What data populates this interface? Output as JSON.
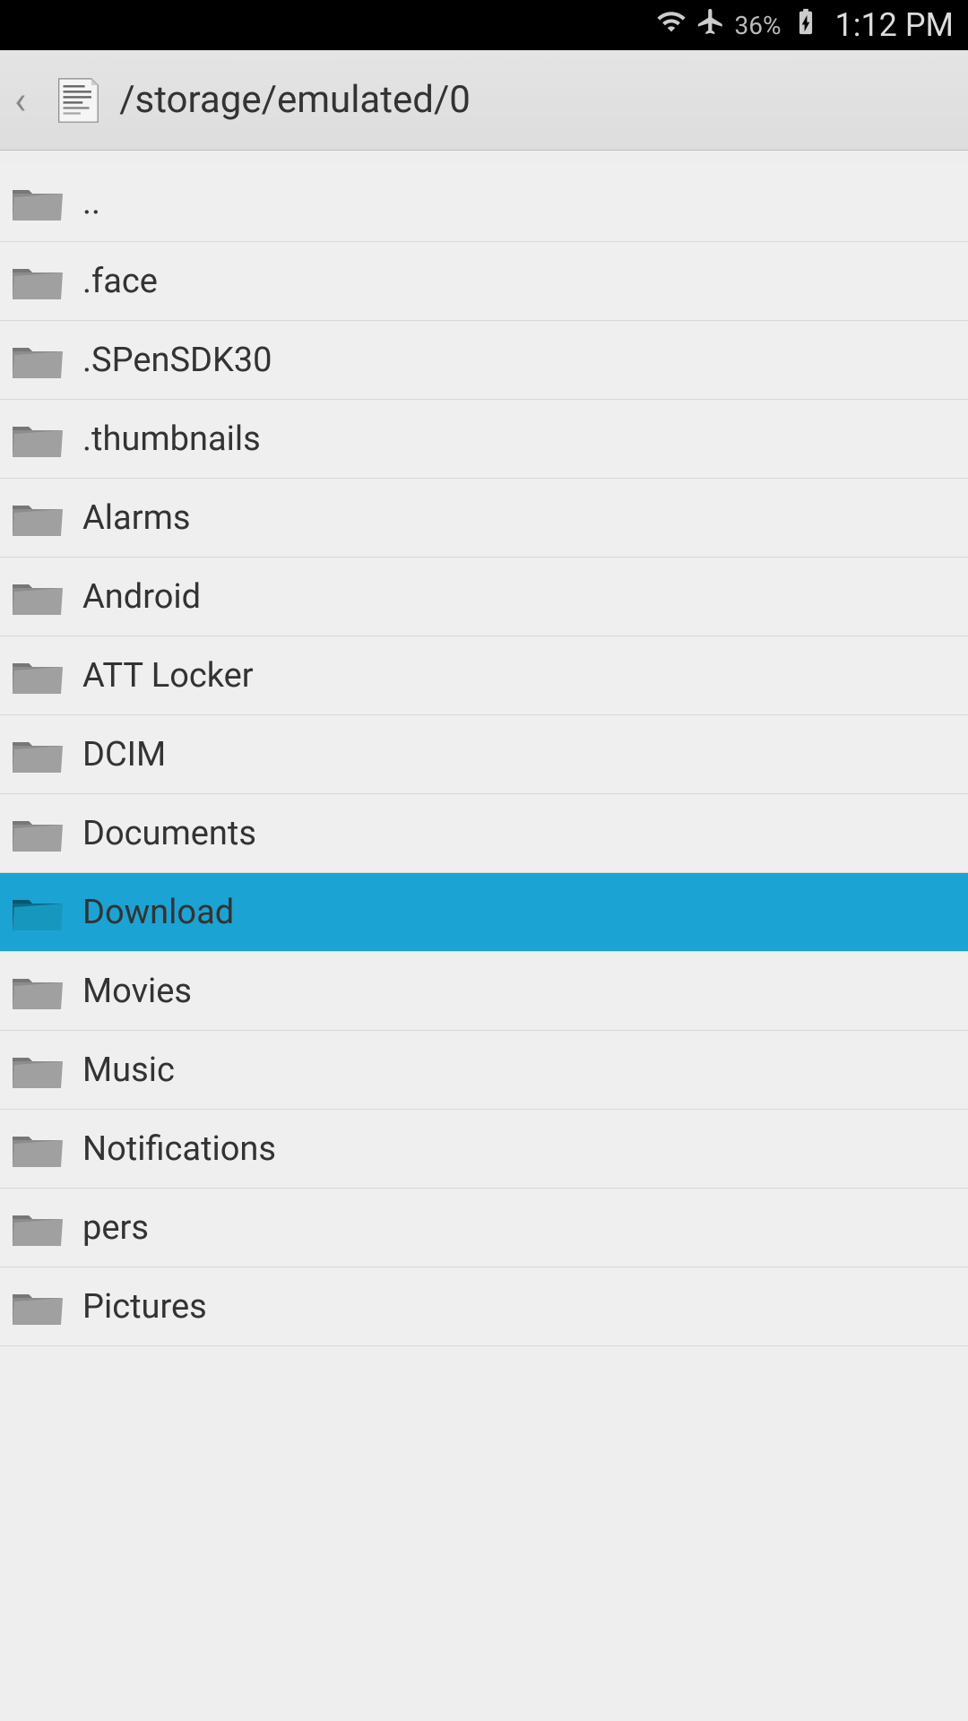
{
  "status": {
    "battery": "36%",
    "time": "1:12 PM"
  },
  "header": {
    "path": "/storage/emulated/0"
  },
  "folders": [
    {
      "name": "..",
      "selected": false
    },
    {
      "name": ".face",
      "selected": false
    },
    {
      "name": ".SPenSDK30",
      "selected": false
    },
    {
      "name": ".thumbnails",
      "selected": false
    },
    {
      "name": "Alarms",
      "selected": false
    },
    {
      "name": "Android",
      "selected": false
    },
    {
      "name": "ATT Locker",
      "selected": false
    },
    {
      "name": "DCIM",
      "selected": false
    },
    {
      "name": "Documents",
      "selected": false
    },
    {
      "name": "Download",
      "selected": true
    },
    {
      "name": "Movies",
      "selected": false
    },
    {
      "name": "Music",
      "selected": false
    },
    {
      "name": "Notifications",
      "selected": false
    },
    {
      "name": "pers",
      "selected": false
    },
    {
      "name": "Pictures",
      "selected": false
    }
  ],
  "colors": {
    "selected_bg": "#1ba3d4",
    "folder_gray": "#8c8c8c",
    "folder_selected": "#0e6a8a"
  }
}
